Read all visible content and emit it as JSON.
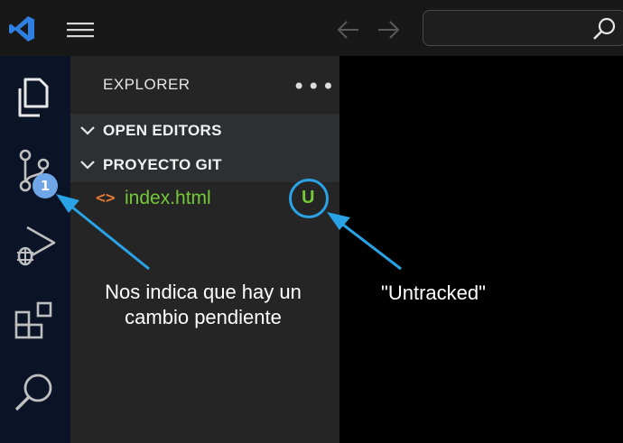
{
  "sidebar": {
    "title": "EXPLORER",
    "more": "•••",
    "sections": [
      {
        "label": "OPEN EDITORS"
      },
      {
        "label": "PROYECTO GIT"
      }
    ],
    "files": [
      {
        "icon": "<>",
        "name": "index.html",
        "status": "U"
      }
    ]
  },
  "activity": {
    "scm_badge": "1",
    "icons": [
      "files-icon",
      "source-control-icon",
      "run-debug-icon",
      "extensions-icon",
      "search-icon"
    ]
  },
  "annotations": {
    "badge_note": "Nos indica que hay un cambio pendiente",
    "status_note": "\"Untracked\""
  },
  "colors": {
    "accent": "#29a3e6",
    "untracked": "#73c936",
    "badge": "#6fa6e8",
    "html_icon": "#e37933"
  }
}
